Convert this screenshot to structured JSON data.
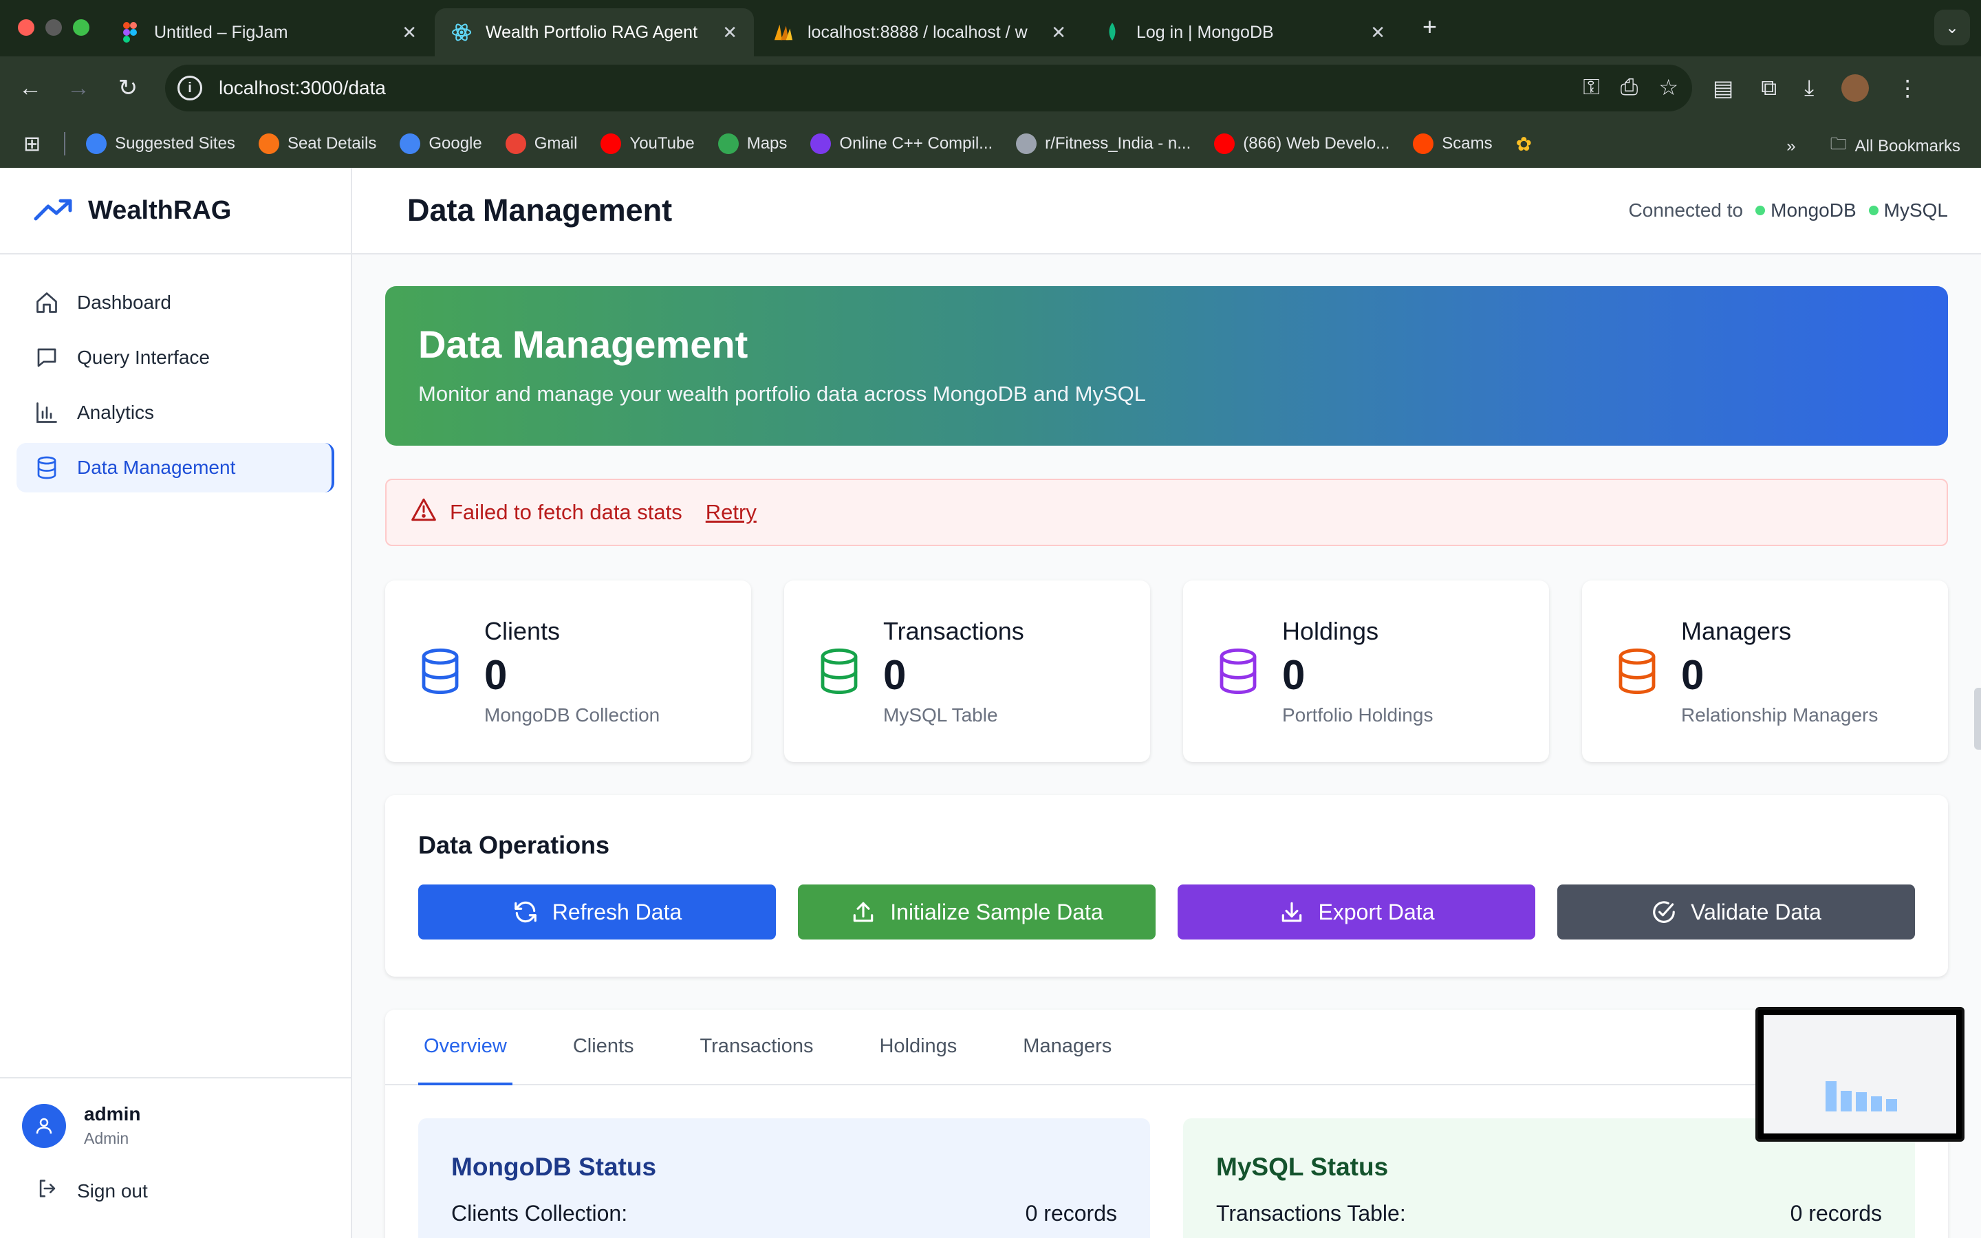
{
  "browser": {
    "tabs": [
      {
        "title": "Untitled – FigJam",
        "icon": "figma-icon"
      },
      {
        "title": "Wealth Portfolio RAG Agent",
        "icon": "react-icon"
      },
      {
        "title": "localhost:8888 / localhost / w",
        "icon": "phpmyadmin-icon"
      },
      {
        "title": "Log in | MongoDB",
        "icon": "mongodb-leaf-icon"
      }
    ],
    "url": "localhost:3000/data",
    "bookmarks": [
      {
        "label": "Suggested Sites",
        "icon": "search-icon",
        "color": "#3b82f6"
      },
      {
        "label": "Seat Details",
        "icon": "seat-icon",
        "color": "#f97316"
      },
      {
        "label": "Google",
        "icon": "google-icon",
        "color": "#4285f4"
      },
      {
        "label": "Gmail",
        "icon": "gmail-icon",
        "color": "#ea4335"
      },
      {
        "label": "YouTube",
        "icon": "youtube-icon",
        "color": "#ff0000"
      },
      {
        "label": "Maps",
        "icon": "maps-icon",
        "color": "#34a853"
      },
      {
        "label": "Online C++ Compil...",
        "icon": "bolt-icon",
        "color": "#7c3aed"
      },
      {
        "label": "r/Fitness_India - n...",
        "icon": "globe-icon",
        "color": "#9ca3af"
      },
      {
        "label": "(866) Web Develo...",
        "icon": "youtube-icon",
        "color": "#ff0000"
      },
      {
        "label": "Scams",
        "icon": "reddit-icon",
        "color": "#ff4500"
      }
    ],
    "all_bookmarks": "All Bookmarks"
  },
  "app": {
    "brand": "WealthRAG",
    "nav": [
      {
        "label": "Dashboard",
        "icon": "home-icon"
      },
      {
        "label": "Query Interface",
        "icon": "chat-icon"
      },
      {
        "label": "Analytics",
        "icon": "bar-chart-icon"
      },
      {
        "label": "Data Management",
        "icon": "database-icon"
      }
    ],
    "user": {
      "name": "admin",
      "role": "Admin"
    },
    "signout": "Sign out",
    "page_title": "Data Management",
    "connected_label": "Connected to",
    "connections": [
      "MongoDB",
      "MySQL"
    ]
  },
  "hero": {
    "title": "Data Management",
    "subtitle": "Monitor and manage your wealth portfolio data across MongoDB and MySQL"
  },
  "alert": {
    "message": "Failed to fetch data stats",
    "retry": "Retry"
  },
  "stats": [
    {
      "label": "Clients",
      "value": "0",
      "sub": "MongoDB Collection",
      "color": "#2563eb"
    },
    {
      "label": "Transactions",
      "value": "0",
      "sub": "MySQL Table",
      "color": "#16a34a"
    },
    {
      "label": "Holdings",
      "value": "0",
      "sub": "Portfolio Holdings",
      "color": "#9333ea"
    },
    {
      "label": "Managers",
      "value": "0",
      "sub": "Relationship Managers",
      "color": "#ea580c"
    }
  ],
  "operations": {
    "title": "Data Operations",
    "buttons": [
      {
        "label": "Refresh Data",
        "icon": "refresh-icon"
      },
      {
        "label": "Initialize Sample Data",
        "icon": "upload-icon"
      },
      {
        "label": "Export Data",
        "icon": "download-icon"
      },
      {
        "label": "Validate Data",
        "icon": "check-circle-icon"
      }
    ]
  },
  "tabs": [
    "Overview",
    "Clients",
    "Transactions",
    "Holdings",
    "Managers"
  ],
  "status": {
    "mongo": {
      "title": "MongoDB Status",
      "row_label": "Clients Collection:",
      "row_value": "0 records"
    },
    "mysql": {
      "title": "MySQL Status",
      "row_label": "Transactions Table:",
      "row_value": "0 records"
    }
  }
}
